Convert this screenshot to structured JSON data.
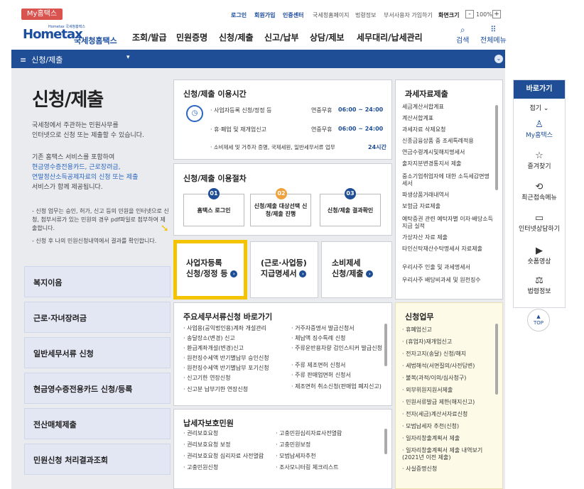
{
  "topbar": {
    "my_badge": "My홈택스",
    "login": "로그인",
    "signup": "회원가입",
    "cert_center": "인증센터",
    "nts_home": "국세청홈페이지",
    "law_info": "법령정보",
    "business_signup": "부서사용자 가입하기",
    "zoom_out": "-",
    "zoom_level": "100%",
    "zoom_in": "+",
    "font_size": "화면크기"
  },
  "header": {
    "logo_text": "Hometax",
    "logo_sub": "국세청홈택스",
    "logo_tiny": "Hometax 국세청홈택스",
    "nav": [
      "조회/발급",
      "민원증명",
      "신청/제출",
      "신고/납부",
      "상담/제보",
      "세무대리/납세관리"
    ],
    "search_label": "검색",
    "allmenu_label": "전체메뉴"
  },
  "breadcrumb": {
    "label": "신청/제출",
    "menu_glyph": "≡"
  },
  "page": {
    "title": "신청/제출",
    "desc1": "국세청에서 주관하는 민원사무를",
    "desc2": "인터넷으로 신청 또는 제출할 수 있습니다.",
    "desc3": "기존 홈택스 서비스를 포함하여",
    "desc4": "현금영수증전용카드, 근로장려금,",
    "desc5": "연말정산소득공제자료의 신청 또는 제출",
    "desc6": "서비스가 함께 제공됩니다.",
    "note1": "- 신청 업무는 승인, 허가, 신고 등의 민원을 인터넷으로 신청, 첨부서류가 있는 민원의 경우 pdf파일로 첨부하여 제출합니다.",
    "note2": "- 신청 후 나의 민원신청내역에서 결과를 확인합니다."
  },
  "left_buttons": [
    "복지이음",
    "근로·자녀장려금",
    "일반세무서류 신청",
    "현금영수증전용카드 신청/등록",
    "전산매체제출",
    "민원신청 처리결과조회"
  ],
  "hours": {
    "title": "신청/제출 이용시간",
    "rows": [
      {
        "label": "· 사업자등록 신청/정정 등",
        "days": "연중무휴",
        "time": "06:00 ~ 24:00"
      },
      {
        "label": "· 휴·폐업 및 재개업신고",
        "days": "연중무휴",
        "time": "06:00 ~ 24:00"
      },
      {
        "label": "· 소비제세 및 거주자 증명, 국제세원, 일반세무서류 업무",
        "days": "",
        "time": "24시간"
      }
    ]
  },
  "procedure": {
    "title": "신청/제출 이용절차",
    "steps": [
      {
        "num": "01",
        "label": "홈택스 로그인"
      },
      {
        "num": "02",
        "label": "신청/제출 대상선택 신청/제출 진행"
      },
      {
        "num": "03",
        "label": "신청/제출 결과확인"
      }
    ]
  },
  "big_buttons": [
    {
      "line1": "사업자등록",
      "line2": "신청/정정 등"
    },
    {
      "line1": "(근로·사업등)",
      "line2": "지급명세서"
    },
    {
      "line1": "소비제세",
      "line2": "신청/제출"
    }
  ],
  "tax_data": {
    "title": "과세자료제출",
    "items": [
      "세금계산서합계표",
      "계산서합계표",
      "과세자료 삭제요청",
      "신종금융상품 중 조세특례적용",
      "연금수령계시및해지명세서",
      "출자지분변경통지서 제출",
      "중소기업취업자에 대한 소득세감면명세서",
      "파생상품거래내역서",
      "보험금 자료제출",
      "예탁증권 관련 예탁자별 이자·배당소득 지급 실적",
      "가상자산 자료 제출",
      "타인신탁재산수탁명세서 자료제출",
      "우리사주 인출 및 과세명세서",
      "우리사주 배당비과세 및 원천징수"
    ]
  },
  "shortcuts": {
    "title": "주요세무서류신청 바로가기",
    "col1": [
      "· 사업용(공익법인용)계좌 개설관리",
      "· 송달장소(변경) 신고",
      "· 환급계좌개설(변경)신고",
      "· 원천징수세액 반기별납부 승인신청",
      "· 원천징수세액 반기별납부 포기신청",
      "· 신고기한 연장신청",
      "· 신고분 납부기한 연장신청"
    ],
    "col2": [
      "· 거주자증명서 발급신청서",
      "· 체납액 징수특례 신청",
      "· 주류운반용차량 검인스티커 발급신청",
      "· 주류 제조면허 신청서",
      "· 주류 판매업면허 신청서",
      "· 제조면허 취소신청(판매업 폐지신고)"
    ]
  },
  "protection": {
    "title": "납세자보호민원",
    "col1": [
      "· 권리보호요청",
      "· 권리보호요청 보정",
      "· 권리보호요청 심리자료 사전열람",
      "· 고충민원신청"
    ],
    "col2": [
      "· 고충민원심리자료사전열람",
      "· 고충민원보정",
      "· 모범납세자추천",
      "· 조사모니터링 체크리스트"
    ]
  },
  "apply": {
    "title": "신청업무",
    "items": [
      "· 휴폐업신고",
      "· (휴업자)재개업신고",
      "· 전자고지(송달) 신청/해지",
      "· 세법해석(서면질의/사전답변)",
      "· 불복(과적/이의/심사청구)",
      "· 외부위원지원서제출",
      "· 민원서류발급 제한(해지신고)",
      "· 전자(세금)계산서자료신청",
      "· 모범납세자 추천(신청)",
      "· 일자리창출계획서 제출",
      "· 일자리창출계획서 제출 내역보기 (2021년 이전 제출)",
      "· 사실증명신청"
    ]
  },
  "quick": {
    "title": "바로가기",
    "collapse": "접기 ⌄",
    "items": [
      {
        "icon": "♙",
        "label": "My홈택스",
        "active": true
      },
      {
        "icon": "☆",
        "label": "즐겨찾기"
      },
      {
        "icon": "⟲",
        "label": "최근접속메뉴"
      },
      {
        "icon": "▭",
        "label": "인터넷상담하기"
      },
      {
        "icon": "▶",
        "label": "숏폼영상"
      },
      {
        "icon": "⚖",
        "label": "법령정보"
      }
    ],
    "top": "TOP"
  },
  "colors": {
    "brand": "#1f4e96",
    "highlight": "#f5c400",
    "step2": "#f0a03c"
  }
}
